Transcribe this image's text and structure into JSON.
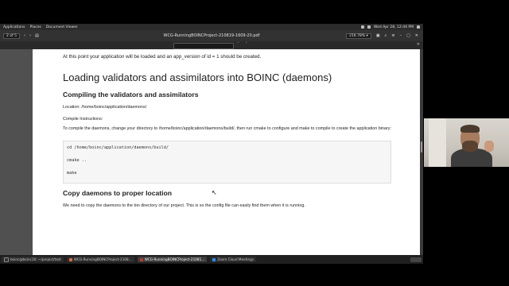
{
  "desktop": {
    "menu": [
      "Applications",
      "Places",
      "Document Viewer"
    ],
    "clock": "Wed Apr 28, 12:44 PM"
  },
  "viewer": {
    "window_title": "WCG-RunningBOINCProject-210819-1609-20.pdf",
    "page_num": "2",
    "page_total": "of 5",
    "zoom": "216.78%"
  },
  "document": {
    "intro": "At this point your application will be loaded and an app_version of id = 1 should be created.",
    "heading1": "Loading validators and assimilators into BOINC (daemons)",
    "heading2a": "Compiling the validators and assimilators",
    "location": "Location:  /home/boinc/application/daemons/",
    "compile_instructions": "Compile Instructions:",
    "paragraph": "To compile the daemons, change your directory to /home/boinc/application/daemons/build/, then run cmake to configure and make to compile to create the application binary:",
    "code_lines": [
      "cd /home/boinc/application/daemons/build/",
      "cmake ..",
      "make"
    ],
    "heading2b": "Copy daemons to proper location",
    "paragraph2": "We need to copy the daemons to the bin directory of our project.  This is so the config file can easily find them when it is running."
  },
  "taskbar": {
    "items": [
      {
        "label": "boinc@boinc10: ~/project/test",
        "icon": "terminal-icon",
        "color": "#333333"
      },
      {
        "label": "WCG-RunningBOINCProject-2108...",
        "icon": "browser-icon",
        "color": "#e06c3c"
      },
      {
        "label": "WCG-RunningBOINCProject-21081...",
        "icon": "pdf-icon",
        "color": "#c0392b"
      },
      {
        "label": "Zoom Cloud Meetings",
        "icon": "zoom-icon",
        "color": "#2d8cff"
      }
    ]
  }
}
